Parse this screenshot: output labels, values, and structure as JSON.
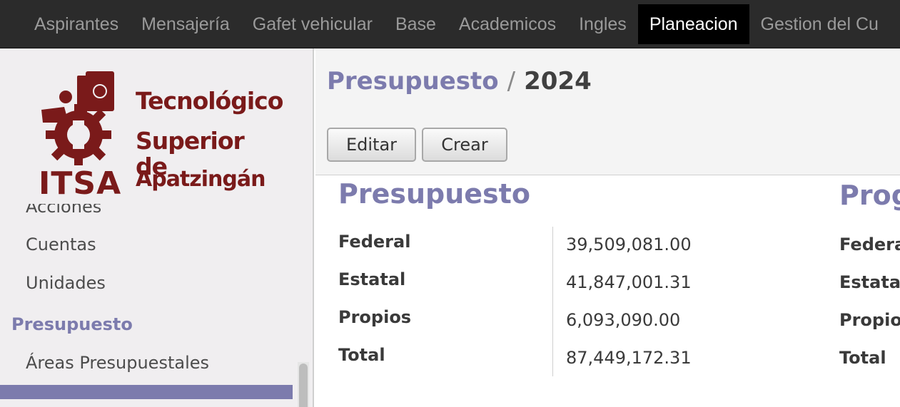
{
  "topnav": {
    "items": [
      {
        "label": "Aspirantes"
      },
      {
        "label": "Mensajería"
      },
      {
        "label": "Gafet vehicular"
      },
      {
        "label": "Base"
      },
      {
        "label": "Academicos"
      },
      {
        "label": "Ingles"
      },
      {
        "label": "Planeacion",
        "active": true
      },
      {
        "label": "Gestion del Cu"
      }
    ]
  },
  "sidebar": {
    "logo": {
      "acronym": "ITSA",
      "line1": "Tecnológico",
      "line2": "Superior de",
      "line3": "Apatzingán",
      "color": "#7a1a1a"
    },
    "items": [
      {
        "label": "Acciones"
      },
      {
        "label": "Cuentas"
      },
      {
        "label": "Unidades"
      }
    ],
    "section_heading": "Presupuesto",
    "section_items": [
      {
        "label": "Áreas Presupuestales"
      }
    ]
  },
  "breadcrumb": {
    "parent": "Presupuesto",
    "separator": "/",
    "current": "2024"
  },
  "buttons": {
    "edit": "Editar",
    "create": "Crear"
  },
  "form": {
    "section1": {
      "title": "Presupuesto",
      "fields": [
        {
          "label": "Federal",
          "value": "39,509,081.00"
        },
        {
          "label": "Estatal",
          "value": "41,847,001.31"
        },
        {
          "label": "Propios",
          "value": "6,093,090.00"
        },
        {
          "label": "Total",
          "value": "87,449,172.31"
        }
      ]
    },
    "section2": {
      "title": "Prog",
      "fields": [
        {
          "label": "Federa"
        },
        {
          "label": "Estatal"
        },
        {
          "label": "Propio"
        },
        {
          "label": "Total"
        }
      ]
    }
  },
  "colors": {
    "accent": "#7c7bad",
    "topbar": "#2b2b2b",
    "active_tab": "#000000"
  }
}
